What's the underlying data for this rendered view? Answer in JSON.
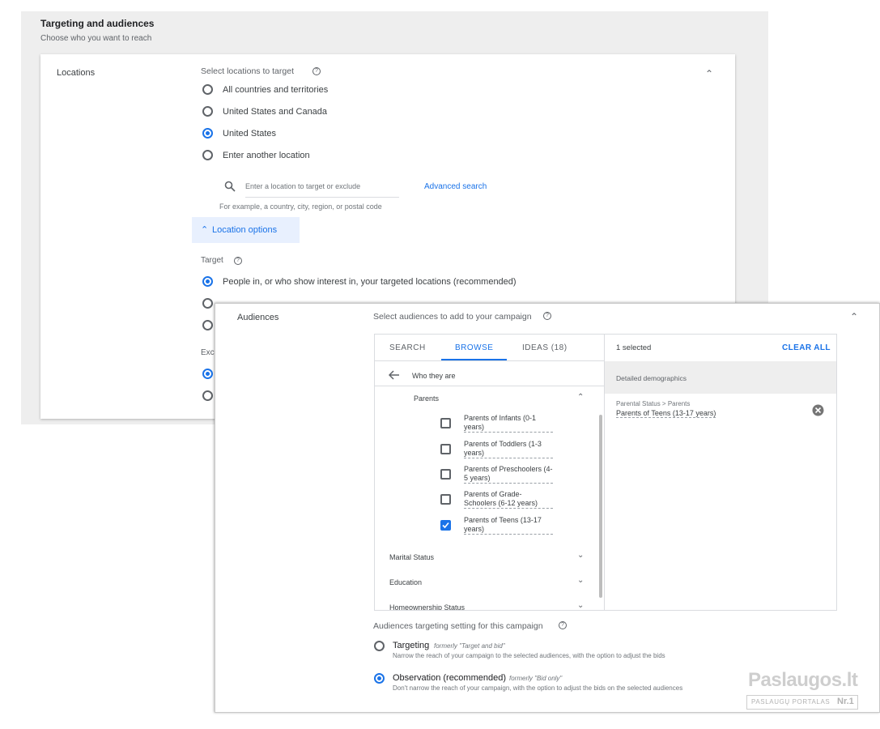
{
  "section": {
    "title": "Targeting and audiences",
    "subtitle": "Choose who you want to reach"
  },
  "locations": {
    "label": "Locations",
    "select_label": "Select locations to target",
    "options": [
      "All countries and territories",
      "United States and Canada",
      "United States",
      "Enter another location"
    ],
    "selected_index": 2,
    "search_placeholder": "Enter a location to target or exclude",
    "advanced_search": "Advanced search",
    "hint": "For example, a country, city, region, or postal code",
    "location_options_button": "Location options",
    "target_label": "Target",
    "target_options": [
      "People in, or who show interest in, your targeted locations (recommended)"
    ],
    "exclude_label_partial": "Exc"
  },
  "audiences": {
    "label": "Audiences",
    "select_label": "Select audiences to add to your campaign",
    "tabs": [
      "SEARCH",
      "BROWSE",
      "IDEAS (18)"
    ],
    "active_tab": 1,
    "back_title": "Who they are",
    "group_title": "Parents",
    "items": [
      {
        "label": "Parents of Infants (0-1 years)",
        "checked": false
      },
      {
        "label": "Parents of Toddlers (1-3 years)",
        "checked": false
      },
      {
        "label": "Parents of Preschoolers (4-5 years)",
        "checked": false
      },
      {
        "label": "Parents of Grade-Schoolers (6-12 years)",
        "checked": false
      },
      {
        "label": "Parents of Teens (13-17 years)",
        "checked": true
      }
    ],
    "collapsed_groups": [
      "Marital Status",
      "Education",
      "Homeownership Status"
    ],
    "selected_count": "1 selected",
    "clear_all": "CLEAR ALL",
    "selected_section": "Detailed demographics",
    "selected_item_path": "Parental Status > Parents",
    "selected_item": "Parents of Teens (13-17 years)",
    "setting_label": "Audiences targeting setting for this campaign",
    "setting_options": [
      {
        "title": "Targeting",
        "formerly": "formerly \"Target and bid\"",
        "desc": "Narrow the reach of your campaign to the selected audiences, with the option to adjust the bids",
        "selected": false
      },
      {
        "title": "Observation (recommended)",
        "formerly": "formerly \"Bid only\"",
        "desc": "Don't narrow the reach of your campaign, with the option to adjust the bids on the selected audiences",
        "selected": true
      }
    ]
  },
  "watermark": {
    "brand": "Paslaugos.lt",
    "tagline": "PASLAUGŲ PORTALAS",
    "rank": "Nr.1"
  },
  "colors": {
    "accent": "#1a73e8",
    "panel_bg": "#eeeeee"
  }
}
